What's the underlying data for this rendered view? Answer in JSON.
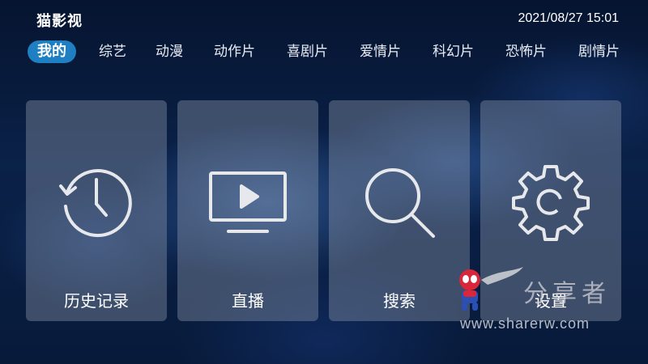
{
  "header": {
    "app_title": "猫影视",
    "datetime": "2021/08/27 15:01"
  },
  "tabs": [
    {
      "label": "我的",
      "active": true
    },
    {
      "label": "综艺",
      "active": false
    },
    {
      "label": "动漫",
      "active": false
    },
    {
      "label": "动作片",
      "active": false
    },
    {
      "label": "喜剧片",
      "active": false
    },
    {
      "label": "爱情片",
      "active": false
    },
    {
      "label": "科幻片",
      "active": false
    },
    {
      "label": "恐怖片",
      "active": false
    },
    {
      "label": "剧情片",
      "active": false
    }
  ],
  "cards": [
    {
      "label": "历史记录",
      "icon": "history-clock-icon"
    },
    {
      "label": "直播",
      "icon": "tv-play-icon"
    },
    {
      "label": "搜索",
      "icon": "search-icon"
    },
    {
      "label": "设置",
      "icon": "gear-icon"
    }
  ],
  "watermark": {
    "brand": "分享者",
    "url": "www.sharerw.com"
  },
  "colors": {
    "active_tab": "#1e7fc2",
    "card_bg": "rgba(150,160,180,0.38)",
    "icon_stroke": "#e6e8ec"
  }
}
